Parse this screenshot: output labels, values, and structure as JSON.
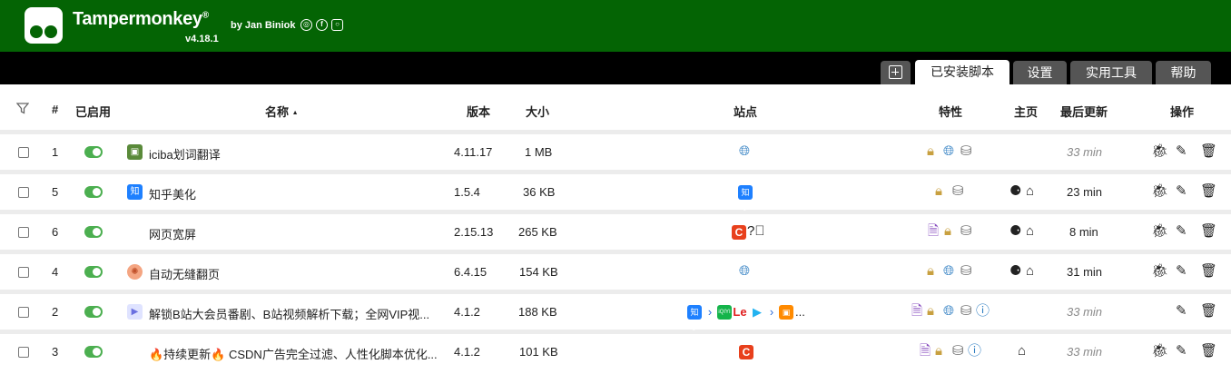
{
  "header": {
    "title": "Tampermonkey",
    "registered": "®",
    "byline": "by Jan Biniok",
    "version": "v4.18.1",
    "social": [
      "github-icon",
      "facebook-icon",
      "instagram-icon"
    ],
    "bg_color": "#046404"
  },
  "tabs": [
    {
      "label": "",
      "icon": "new-script-icon"
    },
    {
      "label": "已安装脚本",
      "active": true
    },
    {
      "label": "设置"
    },
    {
      "label": "实用工具"
    },
    {
      "label": "帮助"
    }
  ],
  "columns": {
    "filter_icon": "filter-icon",
    "num": "#",
    "enabled": "已启用",
    "name": "名称",
    "name_sort": "▲",
    "version": "版本",
    "size": "大小",
    "sites": "站点",
    "features": "特性",
    "homepage": "主页",
    "updated": "最后更新",
    "actions": "操作"
  },
  "scripts": [
    {
      "num": "1",
      "enabled": true,
      "name": "iciba划词翻译",
      "icon": "iciba-icon",
      "version": "4.11.17",
      "size": "1 MB",
      "sites": [
        "globe-icon"
      ],
      "features": [
        "lock-icon",
        "globe-icon",
        "database-icon"
      ],
      "homepage": [],
      "updated": "33 min",
      "updated_muted": true,
      "actions": [
        "bug-icon",
        "edit-icon",
        "trash-icon"
      ]
    },
    {
      "num": "5",
      "enabled": true,
      "name": "知乎美化",
      "icon": "zhihu-icon",
      "version": "1.5.4",
      "size": "36 KB",
      "sites": [
        "zhihu-icon"
      ],
      "features": [
        "lock-icon",
        "database-icon"
      ],
      "homepage": [
        "wrench-icon",
        "home-icon"
      ],
      "updated": "23 min",
      "updated_muted": false,
      "actions": [
        "bug-icon",
        "edit-icon",
        "trash-icon"
      ]
    },
    {
      "num": "6",
      "enabled": true,
      "name": "网页宽屏",
      "icon": "",
      "version": "2.15.13",
      "size": "265 KB",
      "sites": [
        "csdn-icon",
        "question-icon"
      ],
      "features": [
        "page-icon",
        "lock-icon",
        "database-icon"
      ],
      "homepage": [
        "wrench-icon",
        "home-icon"
      ],
      "updated": "8 min",
      "updated_muted": false,
      "actions": [
        "bug-icon",
        "edit-icon",
        "trash-icon"
      ]
    },
    {
      "num": "4",
      "enabled": true,
      "name": "自动无缝翻页",
      "icon": "pager-icon",
      "version": "6.4.15",
      "size": "154 KB",
      "sites": [
        "globe-icon"
      ],
      "features": [
        "lock-icon",
        "globe-icon",
        "database-icon"
      ],
      "homepage": [
        "wrench-icon",
        "home-icon"
      ],
      "updated": "31 min",
      "updated_muted": false,
      "actions": [
        "bug-icon",
        "edit-icon",
        "trash-icon"
      ]
    },
    {
      "num": "2",
      "enabled": true,
      "name": "解锁B站大会员番剧、B站视频解析下载；全网VIP视...",
      "icon": "play-icon",
      "version": "4.1.2",
      "size": "188 KB",
      "sites": [
        "zhihu-icon",
        "youku-icon",
        "iqiyi-icon",
        "letv-icon",
        "tencent-video-icon",
        "youku-icon",
        "mgtv-icon"
      ],
      "sites_more": "...",
      "features": [
        "page-icon",
        "lock-icon",
        "globe-icon",
        "database-icon",
        "info-icon"
      ],
      "homepage": [],
      "updated": "33 min",
      "updated_muted": true,
      "actions": [
        "edit-icon",
        "trash-icon"
      ]
    },
    {
      "num": "3",
      "enabled": true,
      "name": "🔥持续更新🔥 CSDN广告完全过滤、人性化脚本优化...",
      "icon": "",
      "version": "4.1.2",
      "size": "101 KB",
      "sites": [
        "csdn-icon"
      ],
      "features": [
        "page-icon",
        "lock-icon",
        "database-icon",
        "info-icon"
      ],
      "homepage": [
        "home-icon"
      ],
      "updated": "33 min",
      "updated_muted": true,
      "actions": [
        "bug-icon",
        "edit-icon",
        "trash-icon"
      ]
    }
  ],
  "favicons": {
    "zhihu": "知乎",
    "csdn": "C",
    "iqiyi": "iQIYI",
    "letv": "Le",
    "zhihu_icon": "知"
  }
}
